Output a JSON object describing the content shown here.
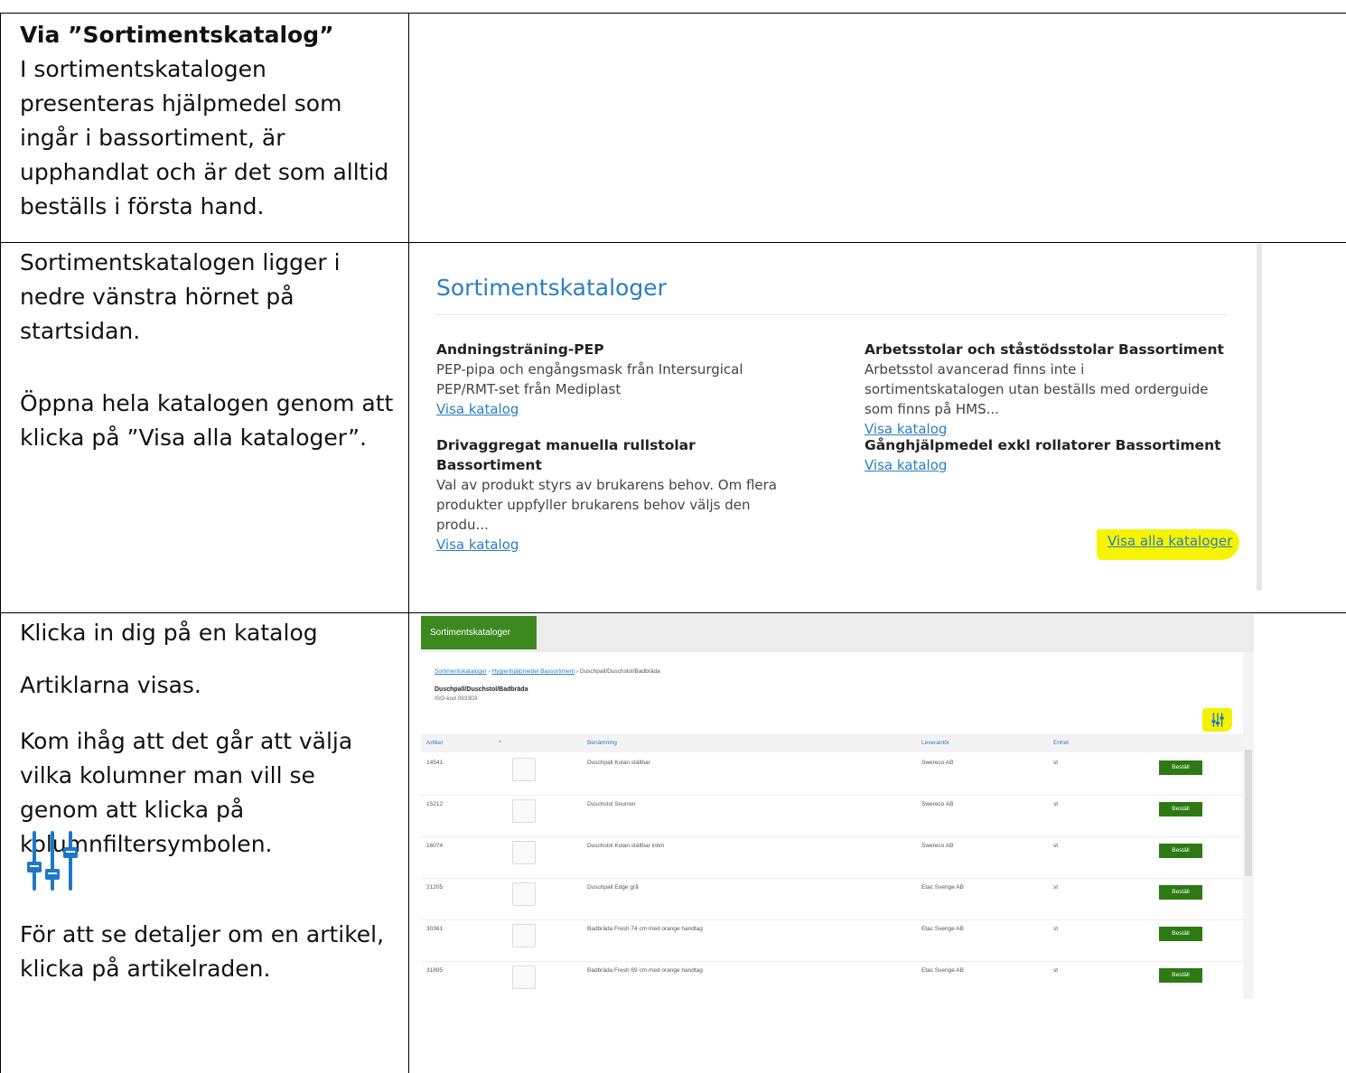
{
  "row1": {
    "heading": "Via ”Sortimentskatalog”",
    "text": "I sortimentskatalogen presenteras hjälpmedel som ingår i bassortiment, är upphandlat och är det som alltid beställs i första hand."
  },
  "row2": {
    "text1": "Sortimentskatalogen ligger i nedre vänstra hörnet på startsidan.",
    "text2": "Öppna hela katalogen genom att klicka på ”Visa alla kataloger”."
  },
  "row3": {
    "text1": "Klicka in dig på en katalog",
    "text2": "Artiklarna visas.",
    "text3": "Kom ihåg att det går att välja vilka kolumner man vill se genom att klicka på kolumnfiltersymbolen.",
    "icon": "column-filter-icon",
    "text4": "För att se detaljer om en artikel, klicka på artikelraden."
  },
  "sortiment": {
    "title": "Sortimentskataloger",
    "catalogs": [
      {
        "name": "Andningsträning-PEP",
        "desc": "PEP-pipa och engångsmask från Intersurgical PEP/RMT-set från Mediplast",
        "link": "Visa katalog"
      },
      {
        "name": "Arbetsstolar och ståstödsstolar Bassortiment",
        "desc": "Arbetsstol avancerad finns inte i sortimentskatalogen utan beställs med orderguide som finns på HMS...",
        "link": "Visa katalog"
      },
      {
        "name": "Drivaggregat manuella rullstolar Bassortiment",
        "desc": "Val av produkt styrs av brukarens behov. Om flera produkter uppfyller brukarens behov väljs den produ...",
        "link": "Visa katalog"
      },
      {
        "name": "Gånghjälpmedel exkl rollatorer Bassortiment",
        "desc": "",
        "link": "Visa katalog"
      }
    ],
    "visa_alla": "Visa alla kataloger",
    "highlight_color": "#f7f400"
  },
  "catalog_page": {
    "tab": "Sortimentskataloger",
    "breadcrumb": {
      "link1": "Sortimentskataloger",
      "sep": "›",
      "link2": "Hygienhjälpmedel Bassortiment",
      "current": "Duschpall/Duschstol/Badbräda"
    },
    "title": "Duschpall/Duschstol/Badbräda",
    "iso": "ISO-kod 093303",
    "columns": {
      "artikel": "Artikel",
      "sort": "^",
      "benamning": "Benämning",
      "leverantor": "Leverantör",
      "enhet": "Enhet"
    },
    "rows": [
      {
        "artikel": "14541",
        "benamning": "Duschpall Kulan ställbar",
        "leverantor": "Swereco AB",
        "enhet": "st",
        "action": "Beställ"
      },
      {
        "artikel": "15212",
        "benamning": "Duschstol Snurren",
        "leverantor": "Swereco AB",
        "enhet": "st",
        "action": "Beställ"
      },
      {
        "artikel": "16074",
        "benamning": "Duschstol Kulan ställbar intim",
        "leverantor": "Swereco AB",
        "enhet": "st",
        "action": "Beställ"
      },
      {
        "artikel": "21205",
        "benamning": "Duschpall Edge grå",
        "leverantor": "Etac Sverige AB",
        "enhet": "st",
        "action": "Beställ"
      },
      {
        "artikel": "30361",
        "benamning": "Badbräda Fresh 74 cm med orange handtag",
        "leverantor": "Etac Sverige AB",
        "enhet": "st",
        "action": "Beställ"
      },
      {
        "artikel": "31895",
        "benamning": "Badbräda Fresh 69 cm med orange handtag",
        "leverantor": "Etac Sverige AB",
        "enhet": "st",
        "action": "Beställ"
      }
    ],
    "accent_green": "#2d7a14",
    "link_blue": "#2a7fc0"
  }
}
